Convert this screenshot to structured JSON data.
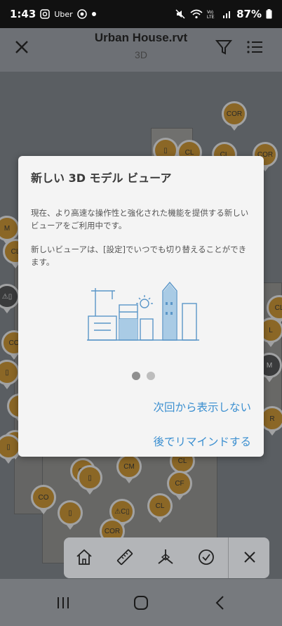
{
  "status_bar": {
    "time": "1:43",
    "app_icons": [
      "instagram-icon",
      "uber-icon",
      "chrome-icon",
      "dot-icon"
    ],
    "uber_label": "Uber",
    "battery": "87%"
  },
  "header": {
    "title": "Urban House.rvt",
    "subtitle": "3D"
  },
  "viewer": {
    "pins": [
      {
        "label": "COR",
        "style": "gold"
      },
      {
        "label": "CL",
        "style": "gold"
      },
      {
        "label": "CL",
        "style": "gold"
      },
      {
        "label": "COR",
        "style": "gold"
      },
      {
        "label": "▯",
        "style": "gold"
      },
      {
        "label": "M",
        "style": "gold"
      },
      {
        "label": "CL",
        "style": "gold"
      },
      {
        "label": "⚠▯",
        "style": "dark"
      },
      {
        "label": "CL",
        "style": "gold"
      },
      {
        "label": "CO",
        "style": "gold"
      },
      {
        "label": "▯",
        "style": "gold"
      },
      {
        "label": "▯",
        "style": "gold"
      },
      {
        "label": "CL",
        "style": "gold"
      },
      {
        "label": "L",
        "style": "gold"
      },
      {
        "label": "M",
        "style": "dark"
      },
      {
        "label": "R",
        "style": "gold"
      },
      {
        "label": "CL",
        "style": "gold"
      },
      {
        "label": "CM",
        "style": "gold"
      },
      {
        "label": "CL",
        "style": "gold"
      },
      {
        "label": "CF",
        "style": "gold"
      },
      {
        "label": "▯",
        "style": "gold"
      },
      {
        "label": "CO",
        "style": "gold"
      },
      {
        "label": "▯",
        "style": "gold"
      },
      {
        "label": "⚠C▯",
        "style": "gold"
      },
      {
        "label": "CL",
        "style": "gold"
      },
      {
        "label": "COR",
        "style": "gold"
      },
      {
        "label": "▯",
        "style": "gold"
      }
    ]
  },
  "dialog": {
    "title": "新しい 3D モデル ビューア",
    "paragraph1": "現在、より高速な操作性と強化された機能を提供する新しいビューアをご利用中です。",
    "paragraph2": "新しいビューアは、[設定]でいつでも切り替えることができます。",
    "pager": {
      "total": 2,
      "current": 1
    },
    "dont_show_again": "次回から表示しない",
    "remind_later": "後でリマインドする"
  },
  "toolbar": {
    "tools": [
      "home-icon",
      "measure-icon",
      "model-browser-icon",
      "issues-icon",
      "close-icon"
    ]
  },
  "colors": {
    "accent": "#3b8fd0",
    "pin_gold": "#b57d17"
  }
}
